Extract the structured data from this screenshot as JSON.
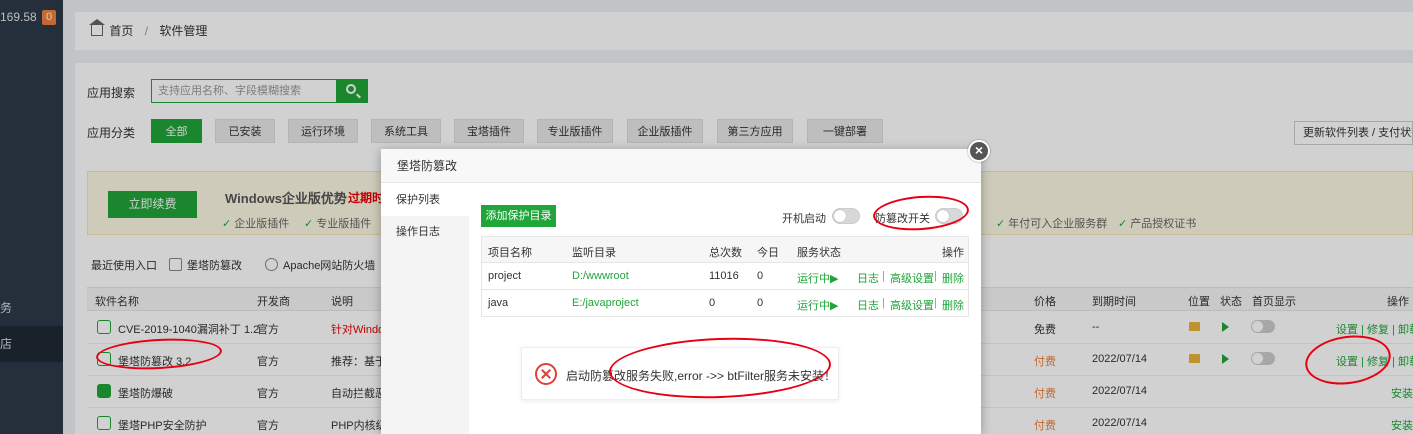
{
  "sidebar": {
    "ip": "169.58",
    "badge": "0",
    "items": [
      {
        "label": "务",
        "active": false
      },
      {
        "label": "店",
        "active": true
      }
    ]
  },
  "breadcrumb": {
    "home": "首页",
    "separator": "/",
    "current": "软件管理"
  },
  "search": {
    "label": "应用搜索",
    "placeholder": "支持应用名称、字段模糊搜索"
  },
  "categories": {
    "label": "应用分类",
    "items": [
      "全部",
      "已安装",
      "运行环境",
      "系统工具",
      "宝塔插件",
      "专业版插件",
      "企业版插件",
      "第三方应用",
      "一键部署"
    ],
    "active": "全部"
  },
  "update_button": "更新软件列表 / 支付状态",
  "promo": {
    "renew_button": "立即续费",
    "title": "Windows企业版优势",
    "expire": "过期时",
    "features": [
      "企业版插件",
      "专业版插件",
      "年付可入企业服务群",
      "产品授权证书"
    ]
  },
  "recent": {
    "label": "最近使用入口",
    "items": [
      "堡塔防篡改",
      "Apache网站防火墙"
    ]
  },
  "table": {
    "headers": [
      "软件名称",
      "开发商",
      "说明",
      "价格",
      "到期时间",
      "位置",
      "状态",
      "首页显示",
      "操作"
    ],
    "rows": [
      {
        "name": "CVE-2019-1040漏洞补丁 1.2",
        "dev": "官方",
        "desc": "针对Windo",
        "price": "免费",
        "expire": "--",
        "actions": "设置 | 修复 | 卸载"
      },
      {
        "name": "堡塔防篡改 3.2",
        "dev": "官方",
        "desc": "推荐：基于",
        "price": "付费",
        "expire": "2022/07/14",
        "actions": "设置 | 修复 | 卸载"
      },
      {
        "name": "堡塔防爆破",
        "dev": "官方",
        "desc": "自动拦截恶",
        "price": "付费",
        "expire": "2022/07/14",
        "actions": "安装"
      },
      {
        "name": "堡塔PHP安全防护",
        "dev": "官方",
        "desc": "PHP内核级",
        "price": "付费",
        "expire": "2022/07/14",
        "actions": "安装"
      }
    ]
  },
  "modal": {
    "title": "堡塔防篡改",
    "close": "×",
    "tabs": [
      "保护列表",
      "操作日志"
    ],
    "add_button": "添加保护目录",
    "switch_boot_label": "开机启动",
    "switch_tamper_label": "防篡改开关",
    "headers": [
      "项目名称",
      "监听目录",
      "总次数",
      "今日",
      "服务状态",
      "操作"
    ],
    "rows": [
      {
        "name": "project",
        "dir": "D:/wwwroot",
        "total": "11016",
        "today": "0",
        "status": "运行中▶",
        "ops": [
          "日志",
          "高级设置",
          "删除"
        ]
      },
      {
        "name": "java",
        "dir": "E:/javaproject",
        "total": "0",
        "today": "0",
        "status": "运行中▶",
        "ops": [
          "日志",
          "高级设置",
          "删除"
        ]
      }
    ],
    "op_sep": "|",
    "error": "启动防篡改服务失败,error ->> btFilter服务未安装！"
  },
  "colors": {
    "accent": "#20a53a",
    "danger": "#e80000",
    "annotation": "#e60012"
  }
}
